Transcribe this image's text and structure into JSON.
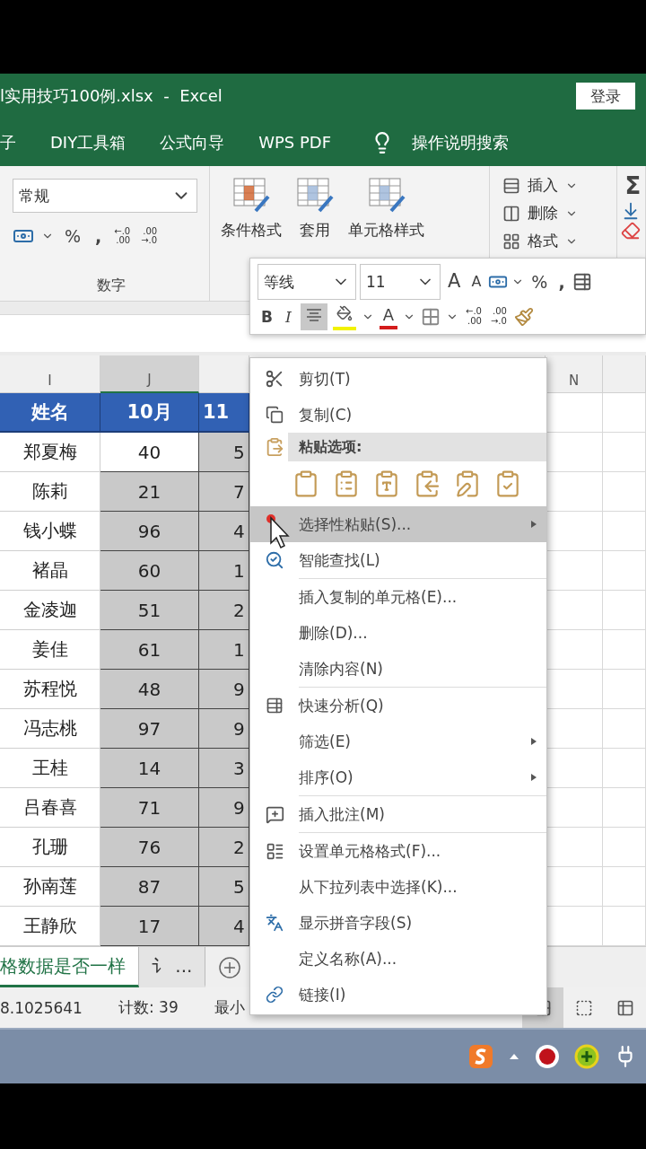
{
  "title_bar": {
    "title": "l实用技巧100例.xlsx  -  Excel",
    "login": "登录"
  },
  "ribbon_tabs": [
    {
      "label": "子"
    },
    {
      "label": "DIY工具箱"
    },
    {
      "label": "公式向导"
    },
    {
      "label": "WPS PDF"
    }
  ],
  "tell_me": {
    "label": "操作说明搜索"
  },
  "ribbon": {
    "number_group": {
      "format": "常规",
      "percent": "%",
      "comma": ",",
      "increase_decimal": [
        "←.0",
        ".00"
      ],
      "decrease_decimal": [
        ".00",
        "→.0"
      ],
      "label": "数字"
    },
    "styles_group": {
      "buttons": [
        "条件格式",
        "套用",
        "单元格样式"
      ]
    },
    "cells_group": {
      "buttons": [
        "插入",
        "删除",
        "格式"
      ]
    },
    "editing_group": {
      "sum": "Σ"
    }
  },
  "mini_toolbar": {
    "font": "等线",
    "size": "11",
    "grow": "A",
    "shrink": "A",
    "percent": "%",
    "comma": ",",
    "bold": "B",
    "italic": "I",
    "center_selected": true,
    "font_color": "A",
    "increase_decimal": [
      "←.0",
      ".00"
    ],
    "decrease_decimal": [
      ".00",
      "→.0"
    ]
  },
  "grid": {
    "columns": [
      {
        "label": "I",
        "selected": false
      },
      {
        "label": "J",
        "selected": true
      }
    ],
    "right_column": "N",
    "header_row": [
      "姓名",
      "10月",
      "11"
    ],
    "rows": [
      {
        "cells": [
          {
            "text": "郑夏梅",
            "selected": false
          },
          {
            "text": "40",
            "selected": false
          },
          {
            "text": "5",
            "selected": true
          }
        ]
      },
      {
        "cells": [
          {
            "text": "陈莉",
            "selected": false
          },
          {
            "text": "21",
            "selected": true
          },
          {
            "text": "7",
            "selected": true
          }
        ]
      },
      {
        "cells": [
          {
            "text": "钱小蝶",
            "selected": false
          },
          {
            "text": "96",
            "selected": true
          },
          {
            "text": "4",
            "selected": true
          }
        ]
      },
      {
        "cells": [
          {
            "text": "褚晶",
            "selected": false
          },
          {
            "text": "60",
            "selected": true
          },
          {
            "text": "1",
            "selected": true
          }
        ]
      },
      {
        "cells": [
          {
            "text": "金凌迦",
            "selected": false
          },
          {
            "text": "51",
            "selected": true
          },
          {
            "text": "2",
            "selected": true
          }
        ]
      },
      {
        "cells": [
          {
            "text": "姜佳",
            "selected": false
          },
          {
            "text": "61",
            "selected": true
          },
          {
            "text": "1",
            "selected": true
          }
        ]
      },
      {
        "cells": [
          {
            "text": "苏程悦",
            "selected": false
          },
          {
            "text": "48",
            "selected": true
          },
          {
            "text": "9",
            "selected": true
          }
        ]
      },
      {
        "cells": [
          {
            "text": "冯志桃",
            "selected": false
          },
          {
            "text": "97",
            "selected": true
          },
          {
            "text": "9",
            "selected": true
          }
        ]
      },
      {
        "cells": [
          {
            "text": "王桂",
            "selected": false
          },
          {
            "text": "14",
            "selected": true
          },
          {
            "text": "3",
            "selected": true
          }
        ]
      },
      {
        "cells": [
          {
            "text": "吕春喜",
            "selected": false
          },
          {
            "text": "71",
            "selected": true
          },
          {
            "text": "9",
            "selected": true
          }
        ]
      },
      {
        "cells": [
          {
            "text": "孔珊",
            "selected": false
          },
          {
            "text": "76",
            "selected": true
          },
          {
            "text": "2",
            "selected": true
          }
        ]
      },
      {
        "cells": [
          {
            "text": "孙南莲",
            "selected": false
          },
          {
            "text": "87",
            "selected": true
          },
          {
            "text": "5",
            "selected": true
          }
        ]
      },
      {
        "cells": [
          {
            "text": "王静欣",
            "selected": false
          },
          {
            "text": "17",
            "selected": true
          },
          {
            "text": "4",
            "selected": true
          }
        ]
      }
    ]
  },
  "sheet_tabs": [
    {
      "label": "格数据是否一样",
      "selected": true
    },
    {
      "label": "讠 ...",
      "selected": false
    }
  ],
  "status_bar": {
    "items": [
      "8.1025641",
      "计数: 39",
      "最小"
    ]
  },
  "context_menu": {
    "items": [
      {
        "kind": "command",
        "label": "剪切(T)",
        "selected": false,
        "submenu": false
      },
      {
        "kind": "command",
        "label": "复制(C)",
        "selected": false,
        "submenu": false
      },
      {
        "kind": "header",
        "label": "粘贴选项:"
      },
      {
        "kind": "paste_options"
      },
      {
        "kind": "command",
        "label": "选择性粘贴(S)...",
        "selected": true,
        "submenu": true
      },
      {
        "kind": "command",
        "label": "智能查找(L)",
        "selected": false,
        "submenu": false
      },
      {
        "kind": "separator"
      },
      {
        "kind": "command",
        "label": "插入复制的单元格(E)...",
        "selected": false,
        "submenu": false
      },
      {
        "kind": "command",
        "label": "删除(D)...",
        "selected": false,
        "submenu": false
      },
      {
        "kind": "command",
        "label": "清除内容(N)",
        "selected": false,
        "submenu": false
      },
      {
        "kind": "separator"
      },
      {
        "kind": "command",
        "label": "快速分析(Q)",
        "selected": false,
        "submenu": false
      },
      {
        "kind": "command",
        "label": "筛选(E)",
        "selected": false,
        "submenu": true
      },
      {
        "kind": "command",
        "label": "排序(O)",
        "selected": false,
        "submenu": true
      },
      {
        "kind": "separator"
      },
      {
        "kind": "command",
        "label": "插入批注(M)",
        "selected": false,
        "submenu": false
      },
      {
        "kind": "separator"
      },
      {
        "kind": "command",
        "label": "设置单元格格式(F)...",
        "selected": false,
        "submenu": false
      },
      {
        "kind": "command",
        "label": "从下拉列表中选择(K)...",
        "selected": false,
        "submenu": false
      },
      {
        "kind": "command",
        "label": "显示拼音字段(S)",
        "selected": false,
        "submenu": false
      },
      {
        "kind": "command",
        "label": "定义名称(A)...",
        "selected": false,
        "submenu": false
      },
      {
        "kind": "command",
        "label": "链接(I)",
        "selected": false,
        "submenu": false
      }
    ]
  }
}
